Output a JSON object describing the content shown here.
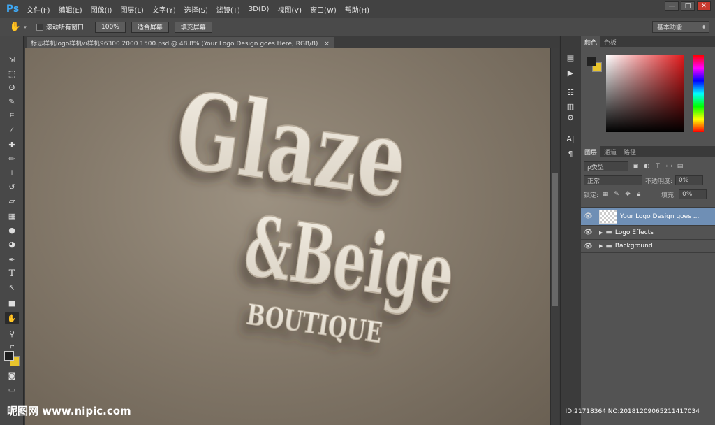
{
  "app": {
    "logo": "Ps"
  },
  "menu": [
    "文件(F)",
    "编辑(E)",
    "图像(I)",
    "图层(L)",
    "文字(Y)",
    "选择(S)",
    "滤镜(T)",
    "3D(D)",
    "视图(V)",
    "窗口(W)",
    "帮助(H)"
  ],
  "window_buttons": [
    "—",
    "□",
    "✕"
  ],
  "options": {
    "scroll_all": "滚动所有窗口",
    "zoom_100": "100%",
    "fit_screen": "适合屏幕",
    "fill_screen": "填充屏幕",
    "workspace": "基本功能"
  },
  "document": {
    "tab_title": "标志样机logo样机vi样机96300 2000 1500.psd @ 48.8% (Your Logo Design goes Here, RGB/8)",
    "close": "×"
  },
  "logo_art": {
    "line1": "Glaze",
    "line2": "&Beige",
    "line3": "BOUTIQUE"
  },
  "color_panel": {
    "tabs": [
      "颜色",
      "色板"
    ],
    "fg_color": "#222222",
    "bg_color": "#e8c42c"
  },
  "layers_panel": {
    "tabs": [
      "图层",
      "通道",
      "路径"
    ],
    "filter": "ρ类型",
    "blend_mode": "正常",
    "opacity_label": "不透明度:",
    "opacity_value": "0%",
    "lock_label": "锁定:",
    "fill_label": "填充:",
    "fill_value": "0%",
    "layers": [
      {
        "name": "Your Logo Design goes ...",
        "selected": true
      },
      {
        "name": "Logo Effects"
      },
      {
        "name": "Background"
      }
    ]
  },
  "watermark": {
    "site": "昵图网 www.nipic.com",
    "id": "ID:21718364 NO:20181209065211417034"
  }
}
